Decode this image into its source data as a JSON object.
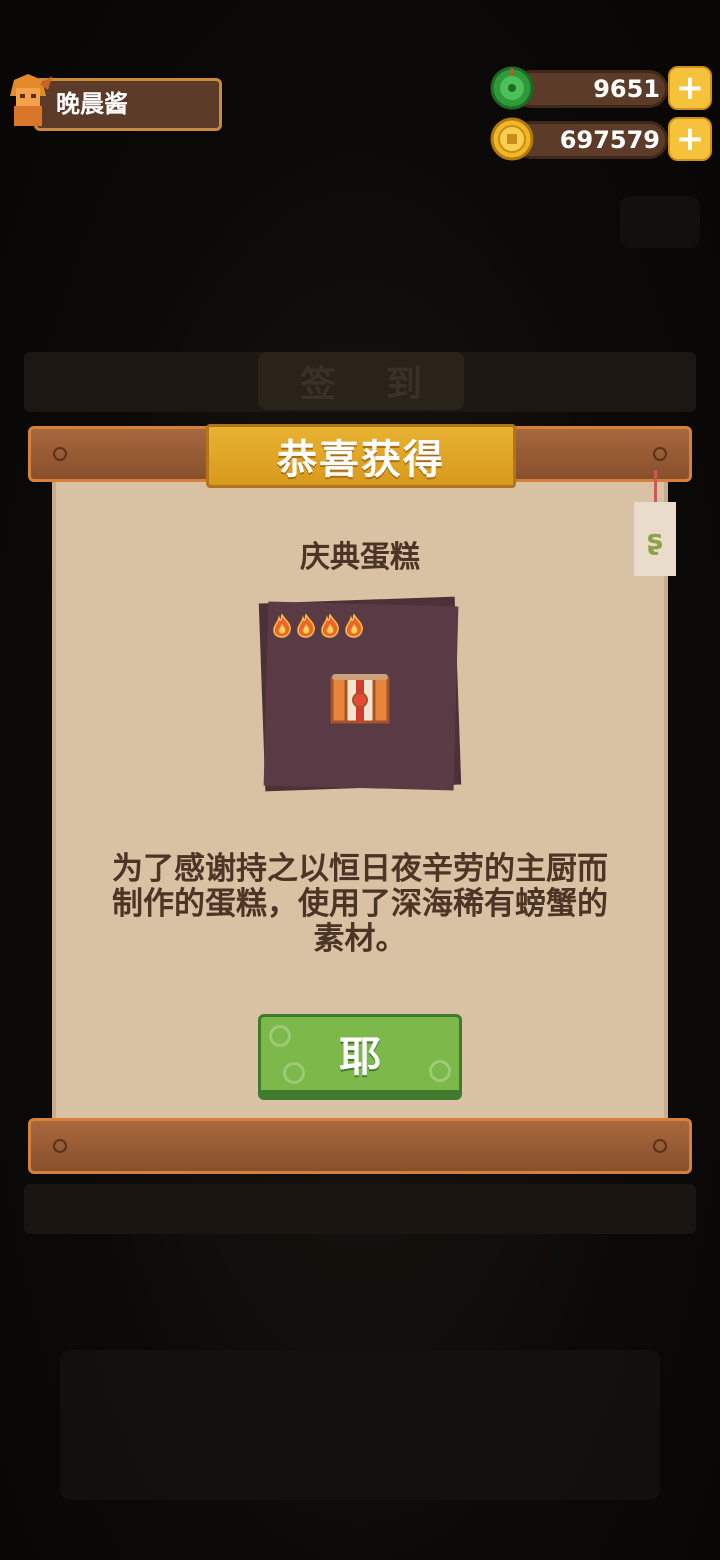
{
  "player": {
    "name": "晚晨酱"
  },
  "resources": {
    "jade": {
      "value": "9651",
      "icon": "jade-coin-icon"
    },
    "gold": {
      "value": "697579",
      "icon": "gold-coin-icon"
    }
  },
  "background": {
    "panel_title": "签到"
  },
  "popup": {
    "title": "恭喜获得",
    "item_name": "庆典蛋糕",
    "rarity_flames": 4,
    "description": "为了感谢持之以恒日夜辛劳的主厨而制作的蛋糕，使用了深海稀有螃蟹的素材。",
    "confirm_label": "耶",
    "side_tag_glyph": "ʂ"
  },
  "colors": {
    "wood": "#a8683e",
    "paper": "#d9c2a3",
    "gold_plate": "#e8b232",
    "confirm_green": "#7cb84a",
    "card": "#5a3b45"
  }
}
